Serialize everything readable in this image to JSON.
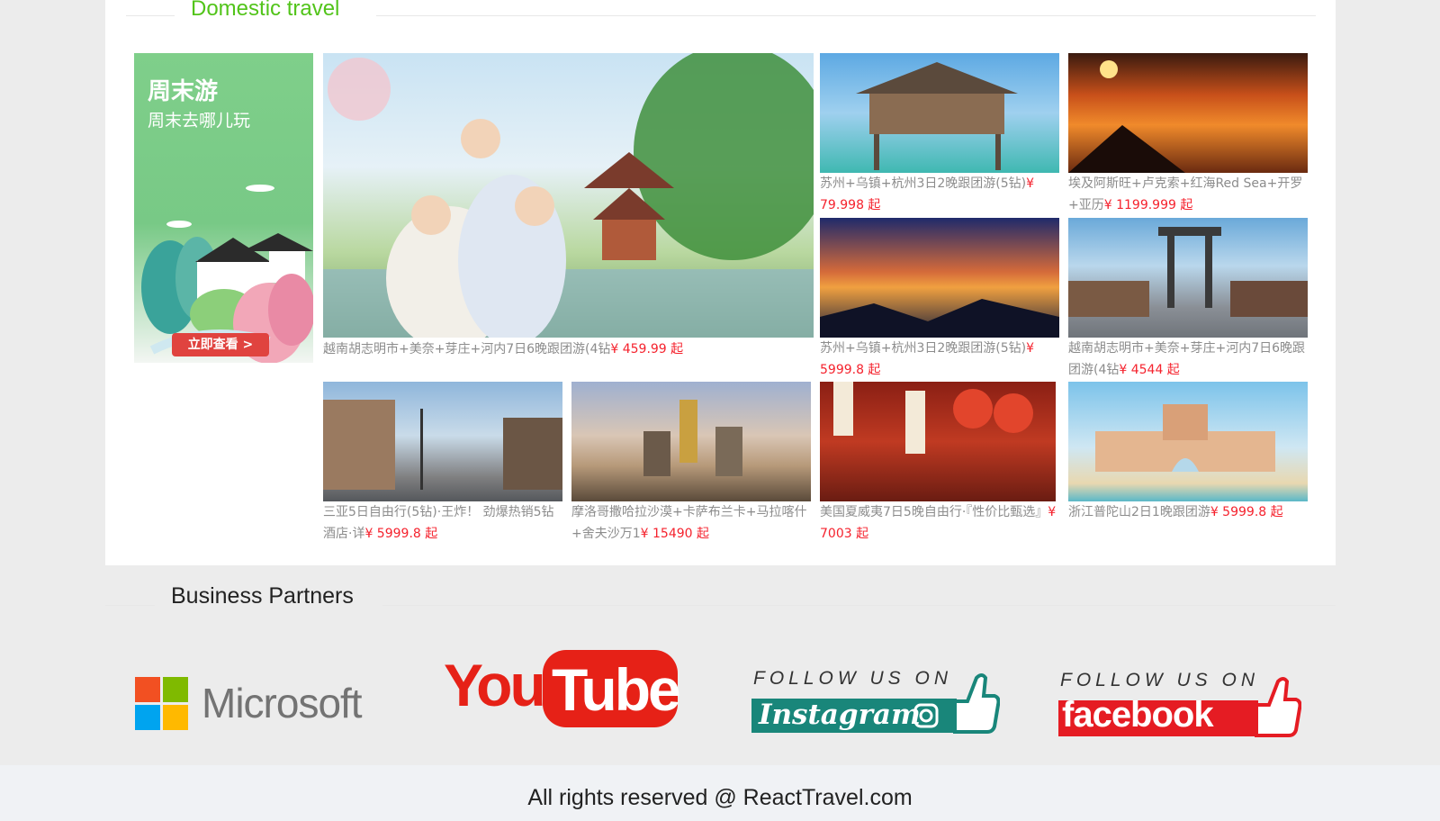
{
  "domestic": {
    "title": "Domestic travel",
    "ad": {
      "title": "周末游",
      "subtitle": "周末去哪儿玩",
      "button": "立即查看 >"
    },
    "cards": [
      {
        "text": "越南胡志明市+美奈+芽庄+河内7日6晚跟团游(4钻",
        "price": "¥ 459.99 起"
      },
      {
        "text": "苏州+乌镇+杭州3日2晚跟团游(5钻)",
        "price": "¥ 79.998 起"
      },
      {
        "text": "埃及阿斯旺+卢克索+红海Red Sea+开罗+亚历",
        "price": "¥ 1199.999 起"
      },
      {
        "text": "苏州+乌镇+杭州3日2晚跟团游(5钻)",
        "price": "¥ 5999.8 起"
      },
      {
        "text": "越南胡志明市+美奈+芽庄+河内7日6晚跟团游(4钻",
        "price": "¥ 4544 起"
      },
      {
        "text": "三亚5日自由行(5钻)·王炸！ 劲爆热销5钻酒店·详",
        "price": "¥ 5999.8 起"
      },
      {
        "text": "摩洛哥撒哈拉沙漠+卡萨布兰卡+马拉喀什+舍夫沙万1",
        "price": "¥ 15490 起"
      },
      {
        "text": "美国夏威夷7日5晚自由行·『性价比甄选』",
        "price": "¥ 7003 起"
      },
      {
        "text": "浙江普陀山2日1晚跟团游",
        "price": "¥ 5999.8 起"
      }
    ]
  },
  "partners": {
    "title": "Business Partners",
    "microsoft": "Microsoft",
    "youtube_you": "You",
    "youtube_tube": "Tube",
    "instagram_follow": "FOLLOW US ON",
    "instagram": "Instagram",
    "facebook_follow": "FOLLOW US ON",
    "facebook": "facebook"
  },
  "footer": {
    "text": "All rights reserved @ ReactTravel.com"
  },
  "colors": {
    "section_title": "#52c41a",
    "price": "#f5222d",
    "caption": "#8c8c8c",
    "youtube_red": "#e62117",
    "instagram_teal": "#19867a",
    "facebook_red": "#e51c23"
  }
}
